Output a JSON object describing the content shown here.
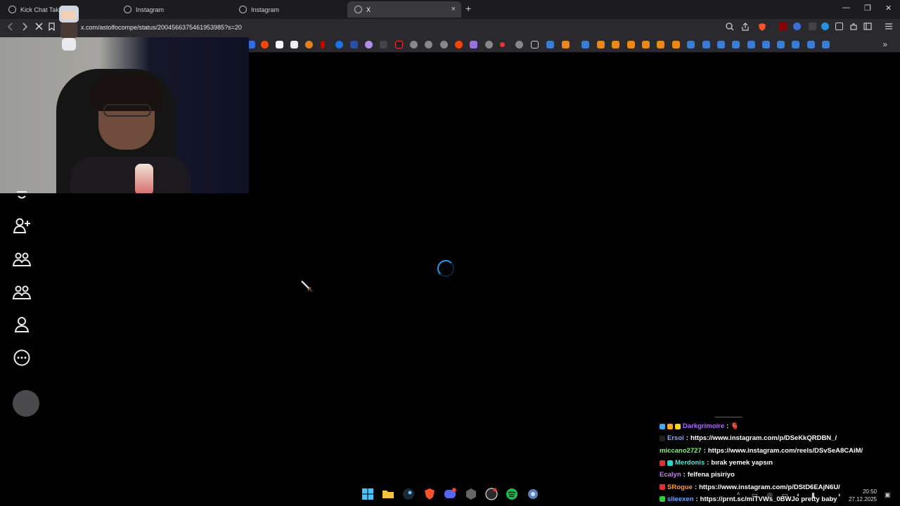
{
  "tabs": [
    {
      "title": "Kick Chat Taking"
    },
    {
      "title": "Instagram"
    },
    {
      "title": "Instagram"
    },
    {
      "title": "X"
    }
  ],
  "new_tab_symbol": "+",
  "window_controls": {
    "minimize": "—",
    "maximize": "❐",
    "close": "✕"
  },
  "address_bar": {
    "url": "x.com/astolfocompe/status/2004566375461953985?s=20"
  },
  "tab_close_symbol": "×",
  "chat": {
    "messages": [
      {
        "user": "Darkgrimoire",
        "user_color": "#b36cff",
        "text": "🫀"
      },
      {
        "user": "Ersoi",
        "user_color": "#9aa8ff",
        "text": "https://www.instagram.com/p/DSeKkQRDBN_/"
      },
      {
        "user": "miccano2727",
        "user_color": "#7cff6b",
        "text": "https://www.instagram.com/reels/DSvSeA8CAiM/"
      },
      {
        "user": "Merdonis",
        "user_color": "#5ee0d0",
        "text": "bırak yemek yapsın"
      },
      {
        "user": "Ecalyn",
        "user_color": "#c77dff",
        "text": "felfena pisiriyo"
      },
      {
        "user": "SRogue",
        "user_color": "#ff9b3d",
        "text": "https://www.instagram.com/p/DStD6EAjN6U/"
      },
      {
        "user": "slieexen",
        "user_color": "#6fa8ff",
        "text": "https://prnt.sc/miTVWs_0BWJo pretty baby"
      }
    ]
  },
  "taskbar": {
    "time": "20:50",
    "date": "27.12.2025"
  },
  "colors": {
    "accent": "#1d9bf0",
    "background": "#000000"
  }
}
